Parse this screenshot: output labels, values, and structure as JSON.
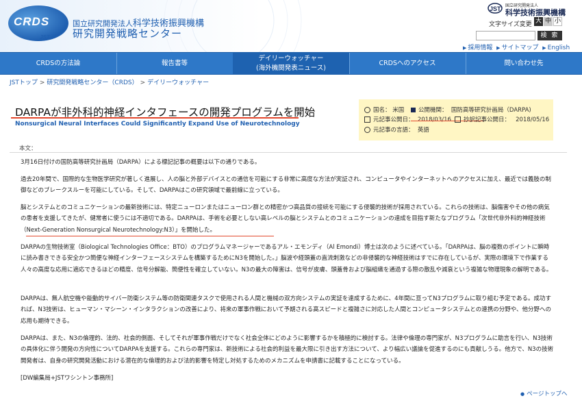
{
  "header": {
    "logo_text": "CRDS",
    "logo_sub": "JST",
    "org_prefix": "国立研究開発法人",
    "org_name_main": "科学技術振興機構",
    "center_name": "研究開発戦略センター",
    "jst_small": "国立研究開発法人",
    "jst_name": "科学技術振興機構",
    "font_size_label": "文字サイズ変更",
    "font_large": "大",
    "font_mid": "中",
    "font_small": "小",
    "search_placeholder": "",
    "search_button": "検 索",
    "util_links": [
      "採用情報",
      "サイトマップ",
      "English"
    ]
  },
  "nav": {
    "items": [
      {
        "label": "CRDSの方法論"
      },
      {
        "label": "報告書等"
      },
      {
        "label_line1": "デイリーウォッチャー",
        "label_line2": "(海外機関発表ニュース)"
      },
      {
        "label": "CRDSへのアクセス"
      },
      {
        "label": "問い合わせ先"
      }
    ]
  },
  "breadcrumb": [
    "JSTトップ",
    "研究開発戦略センター（CRDS）",
    "デイリーウォッチャー"
  ],
  "article": {
    "title": "DARPAが非外科的神経インタフェースの開発プログラムを開始",
    "subtitle": "Nonsurgical Neural Interfaces Could Significantly Expand Use of Neurotechnology",
    "info": {
      "country_label": "国名：",
      "country": "米国",
      "agency_label": "公開機関：",
      "agency": "国防高等研究計画局（DARPA)",
      "orig_date_label": "元記事公開日：",
      "orig_date": "2018/03/16",
      "excerpt_date_label": "抄訳記事公開日：",
      "excerpt_date": "2018/05/16",
      "lang_label": "元記事の言語：",
      "lang": "英語"
    },
    "body_label": "本文：",
    "paragraphs": [
      "3月16日付けの国防高等研究計画局（DARPA）による標記記事の概要は以下の通りである。",
      "過去20年間で、国際的な生物医学研究が著しく進展し、人の脳と外部デバイスとの通信を可能にする非常に高度な方法が実証され、コンピュータやインターネットへのアクセスに加え、最近では義肢の制御などのブレークスルーを可能にしている。そして、DARPAはこの研究領域で最前線に立っている。",
      "脳とシステムとのコミュニケーションの最新技術には、特定ニューロンまたはニューロン群との精密かつ高品質の接続を可能にする侵襲的技術が採用されている。これらの技術は、脳傷害やその他の病気の患者を支援してきたが、健常者に使うには不適切である。DARPAは、手術を必要としない高レベルの脳とシステムとのコミュニケーションの達成を目指す新たなプログラム「次世代非外科的神経技術（Next-Generation Nonsurgical Neurotechnology:N3）」を開始した。",
      "DARPAの生物技術室（Biological Technologies Office：BTO）のプログラムマネージャーであるアル・エモンディ（Al Emondi）博士は次のように述べている。「DARPAは、脳の複数のポイントに瞬時に読み書きできる安全かつ簡便な神経インターフェースシステムを構築するためにN3を開始した。」脳波や経頭蓋の直流刺激などの非侵襲的な神経技術はすでに存在しているが、実際の環境下で作業する人々の高度な応用に適応できるほどの精度、信号分解能、簡便性を確立していない。N3の最大の障害は、信号が皮膚、頭蓋骨および脳組織を通過する際の散乱や減衰という複雑な物理現象の解明である。",
      "DARPAは、無人航空機や能動的サイバー防衛システム等の防衛関連タスクで使用される人間と機械の双方向システムの実証を達成するために、4年間に亘ってN3プログラムに取り組む予定である。成功すれば、N3技術は、ヒューマン・マシーン・インタラクションの改善により、将来の軍事作戦において予期される高スピードと複雑さに対応した人間とコンピュータシステムとの連携の分野や、他分野への応用も期待できる。",
      "DARPAは、また、N3の倫理的、法的、社会的側面、そしてそれが軍事作戦だけでなく社会全体にどのように影響するかを積極的に検討する。法律や倫理の専門家が、N3プログラムに助言を行い、N3技術の具体化に伴う開発の方向性についてDARPAを支援する。これらの専門家は、新技術による社会的利益を最大限に引き出す方法について、より幅広い議論を促進するのにも貢献しうる。他方で、N3の技術開発者は、自身の研究開発活動における潜在的な倫理的および法的影響を特定し対処するためのメカニズムを申請書に記載することになっている。",
      "[DW編集局+JSTワシントン事務所]"
    ],
    "page_top": "ページトップへ"
  },
  "colors": {
    "nav_bg": "#2e78c8",
    "accent_red": "#e3462b",
    "link_blue": "#1f5fb0",
    "infobox_bg": "#fff6c4"
  }
}
